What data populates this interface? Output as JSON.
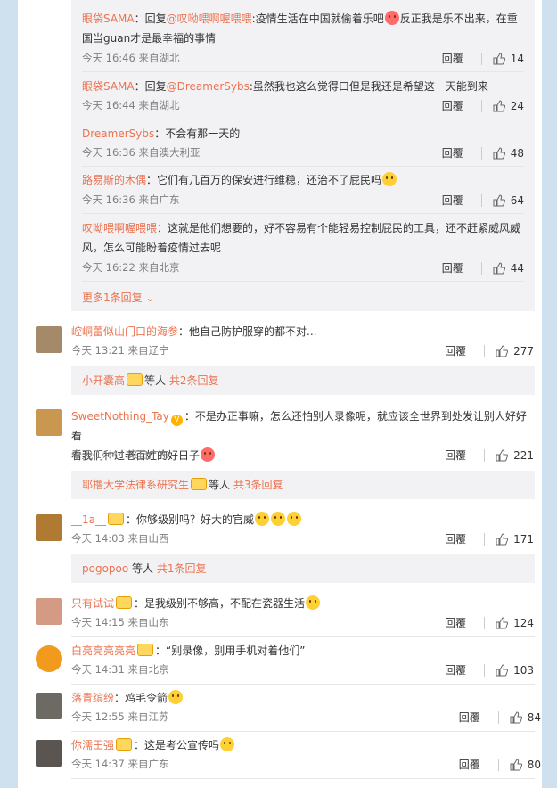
{
  "sub_replies": [
    {
      "name": "眼袋SAMA",
      "prefix": "：回复",
      "mention": "@叹呦喂啊喔喂喂",
      "text": ":疫情生活在中国就偷着乐吧",
      "emoji": "heart-eyes-emoji",
      "text2": "反正我是乐不出来，在重国当guan才是最幸福的事情",
      "time": "今天 16:46 来自湖北",
      "reply": "回覆",
      "likes": "14"
    },
    {
      "name": "眼袋SAMA",
      "prefix": "：回复",
      "mention": "@DreamerSybs",
      "text": ":虽然我也这么觉得口但是我还是希望这一天能到来",
      "time": "今天 16:44 来自湖北",
      "reply": "回覆",
      "likes": "24"
    },
    {
      "name": "DreamerSybs",
      "text": "：不会有那一天的",
      "time": "今天 16:36 来自澳大利亚",
      "reply": "回覆",
      "likes": "48"
    },
    {
      "name": "路易斯的木偶",
      "text": "：它们有几百万的保安进行维稳，还治不了屁民吗",
      "emoji": "grimace-emoji",
      "time": "今天 16:36 来自广东",
      "reply": "回覆",
      "likes": "64"
    },
    {
      "name": "叹呦喂啊喔喂喂",
      "text": "：这就是他们想要的，好不容易有个能轻易控制屁民的工具，还不赶紧威风威",
      "text2": "风，怎么可能盼着疫情过去呢",
      "time": "今天 16:22 来自北京",
      "reply": "回覆",
      "likes": "44"
    }
  ],
  "more_replies": "更多1条回复",
  "comments": [
    {
      "name": "崆峒蕾似山门口的海参",
      "text": "：他自己防护服穿的都不对...",
      "time": "今天 13:21 来自辽宁",
      "reply": "回覆",
      "likes": "277",
      "avatar_color": "#a58a6a",
      "bar": {
        "who": "小开囊高",
        "suffix": "等人",
        "count": "共2条回复"
      }
    },
    {
      "name": "SweetNothing_Tay",
      "text": "：不是办正事嘛，怎么还怕别人录像呢，就应该全世界到处发让别人好好看",
      "text2": "看我们种过老百姓的好日子",
      "time": "今天 14:44 来自广东",
      "reply": "回覆",
      "likes": "221",
      "avatar_color": "#c9974f",
      "bar": {
        "who": "耶撸大学法律系研究生",
        "suffix": "等人",
        "count": "共3条回复"
      }
    },
    {
      "name": "__1a__",
      "text": "：你够级别吗？好大的官威",
      "time": "今天 14:03 来自山西",
      "reply": "回覆",
      "likes": "171",
      "avatar_color": "#b07a32",
      "bar": {
        "who": "pogopoo",
        "suffix": "等人",
        "count": "共1条回复"
      }
    },
    {
      "name": "只有试试",
      "text": "：是我级别不够高，不配在瓷器生活",
      "time": "今天 14:15 来自山东",
      "reply": "回覆",
      "likes": "124",
      "avatar_color": "#d49a84"
    },
    {
      "name": "白亮亮亮亮亮",
      "text": "：“别录像，别用手机对着他们”",
      "time": "今天 14:31 来自北京",
      "reply": "回覆",
      "likes": "103",
      "avatar_color": "#f29a1e"
    },
    {
      "name": "落青缤纷",
      "text": "：鸡毛令箭",
      "time": "今天 12:55 来自江苏",
      "reply": "回覆",
      "likes": "84",
      "avatar_color": "#6d6a64"
    },
    {
      "name": "你濡王强",
      "text": "：这是考公宣传吗",
      "time": "今天 14:37 来自广东",
      "reply": "回覆",
      "likes": "80",
      "avatar_color": "#5a5550"
    }
  ]
}
